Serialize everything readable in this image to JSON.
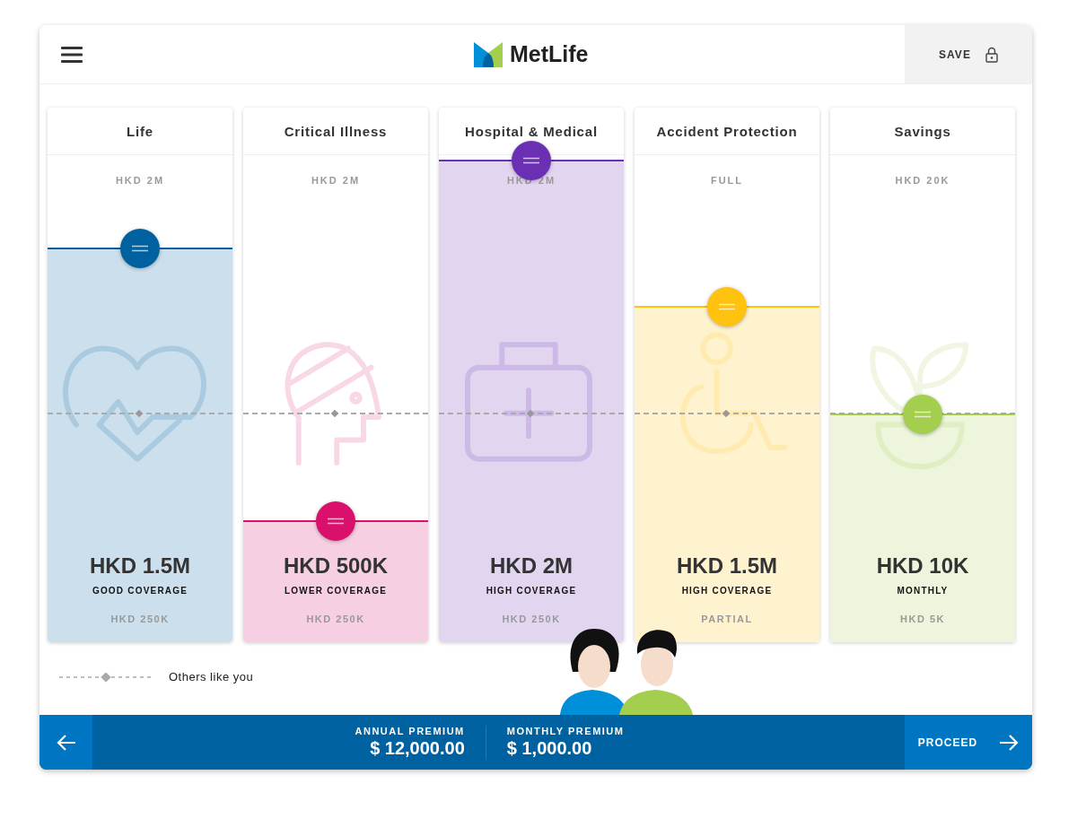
{
  "header": {
    "logo": "MetLife",
    "save": "SAVE"
  },
  "cards": [
    {
      "title": "Life",
      "max": "HKD 2M",
      "value": "HKD 1.5M",
      "rating": "GOOD COVERAGE",
      "min": "HKD 250K",
      "level": 0.81,
      "color": "#0061a0"
    },
    {
      "title": "Critical Illness",
      "max": "HKD 2M",
      "value": "HKD 500K",
      "rating": "LOWER COVERAGE",
      "min": "HKD 250K",
      "level": 0.25,
      "color": "#d9116c"
    },
    {
      "title": "Hospital & Medical",
      "max": "HKD 2M",
      "value": "HKD 2M",
      "rating": "HIGH COVERAGE",
      "min": "HKD 250K",
      "level": 0.99,
      "color": "#6b2fb3"
    },
    {
      "title": "Accident Protection",
      "max": "FULL",
      "value": "HKD 1.5M",
      "rating": "HIGH COVERAGE",
      "min": "PARTIAL",
      "level": 0.69,
      "color": "#ffc20e"
    },
    {
      "title": "Savings",
      "max": "HKD 20K",
      "value": "HKD 10K",
      "rating": "MONTHLY",
      "min": "HKD 5K",
      "level": 0.47,
      "color": "#a4ce4e"
    }
  ],
  "others_like_you": {
    "label": "Others like you",
    "level": 0.47
  },
  "footer": {
    "annual_label": "ANNUAL PREMIUM",
    "annual": "$ 12,000.00",
    "monthly_label": "MONTHLY PREMIUM",
    "monthly": "$ 1,000.00",
    "proceed": "PROCEED"
  }
}
